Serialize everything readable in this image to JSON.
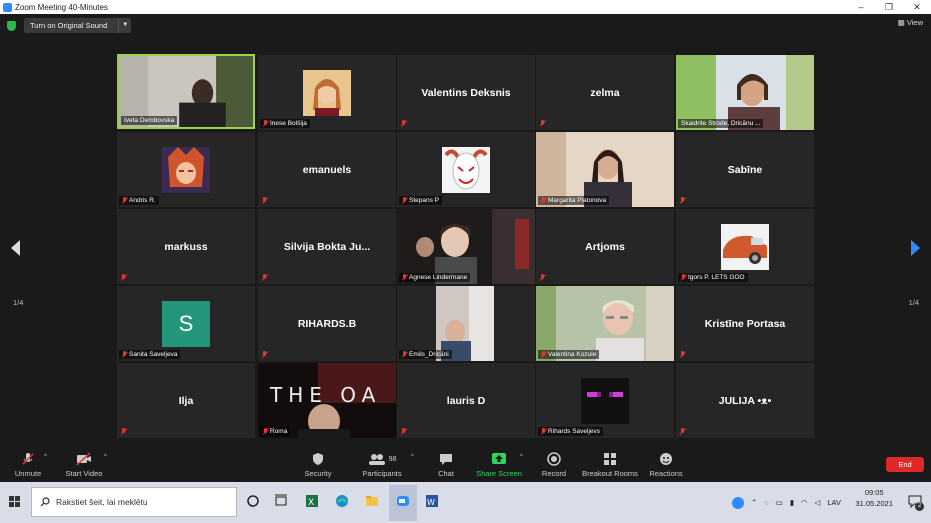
{
  "window": {
    "title": "Zoom Meeting 40-Minutes",
    "minimize": "–",
    "maximize": "❐",
    "close": "✕"
  },
  "topbar": {
    "sound_button": "Turn on Original Sound",
    "view_label": "View"
  },
  "pager": {
    "left": "1/4",
    "right": "1/4"
  },
  "participants": [
    {
      "name": "Iveta Dembovska",
      "label": "Iveta Dembovska",
      "type": "video",
      "active": true
    },
    {
      "name": "Inese Bolšija",
      "label": "Inese Bolšija",
      "type": "photo"
    },
    {
      "name": "Valentins Deksnis",
      "label": "",
      "type": "text"
    },
    {
      "name": "zelma",
      "label": "",
      "type": "text"
    },
    {
      "name": "Skaidrite Strode, Dricānu ...",
      "label": "Skaidrite Strode, Dricānu ...",
      "type": "video"
    },
    {
      "name": "Andris R.",
      "label": "Andris R.",
      "type": "avatar"
    },
    {
      "name": "emanuels",
      "label": "",
      "type": "text"
    },
    {
      "name": "Stepans P",
      "label": "Stepans P",
      "type": "avatar"
    },
    {
      "name": "Margarita Platonova",
      "label": "Margarita Platonova",
      "type": "video"
    },
    {
      "name": "Sabīne",
      "label": "",
      "type": "text"
    },
    {
      "name": "markuss",
      "label": "",
      "type": "text"
    },
    {
      "name": "Silvija Bokta Ju...",
      "label": "",
      "type": "text"
    },
    {
      "name": "Agnese Lindermane",
      "label": "Agnese Lindermane",
      "type": "video"
    },
    {
      "name": "Artjoms",
      "label": "",
      "type": "text"
    },
    {
      "name": "Igors P. LETS GOO",
      "label": "Igors P. LETS GOO",
      "type": "avatar"
    },
    {
      "name": "Sanita Saveljeva",
      "label": "Sanita Saveljeva",
      "type": "letter",
      "letter": "S"
    },
    {
      "name": "RIHARDS.B",
      "label": "",
      "type": "text"
    },
    {
      "name": "Emils_Dricāni",
      "label": "Emils_Dricāni",
      "type": "video"
    },
    {
      "name": "Valentina Kozule",
      "label": "Valentina Kozule",
      "type": "video"
    },
    {
      "name": "Kristīne Portasa",
      "label": "",
      "type": "text"
    },
    {
      "name": "Ilja",
      "label": "",
      "type": "text"
    },
    {
      "name": "Roma",
      "label": "Roma",
      "type": "video",
      "overlay": "THE OA"
    },
    {
      "name": "lauris D",
      "label": "",
      "type": "text"
    },
    {
      "name": "Rihards Saveljevs",
      "label": "Rihards Saveljevs",
      "type": "avatar"
    },
    {
      "name": "JULIJA •ᴥ•",
      "label": "",
      "type": "text"
    }
  ],
  "toolbar": {
    "unmute": "Unmute",
    "start_video": "Start Video",
    "security": "Security",
    "participants": "Participants",
    "participants_count": "98",
    "chat": "Chat",
    "share_screen": "Share Screen",
    "record": "Record",
    "breakout_rooms": "Breakout Rooms",
    "reactions": "Reactions",
    "end": "End"
  },
  "taskbar": {
    "search_placeholder": "Rakstiet šeit, lai meklētu",
    "language": "LAV",
    "time": "09:05",
    "date": "31.05.2021",
    "notifications": "2"
  },
  "colors": {
    "active_border": "#9bd34d",
    "share_green": "#2fd35f",
    "end_red": "#e02828",
    "zoom_blue": "#2d8cff"
  }
}
